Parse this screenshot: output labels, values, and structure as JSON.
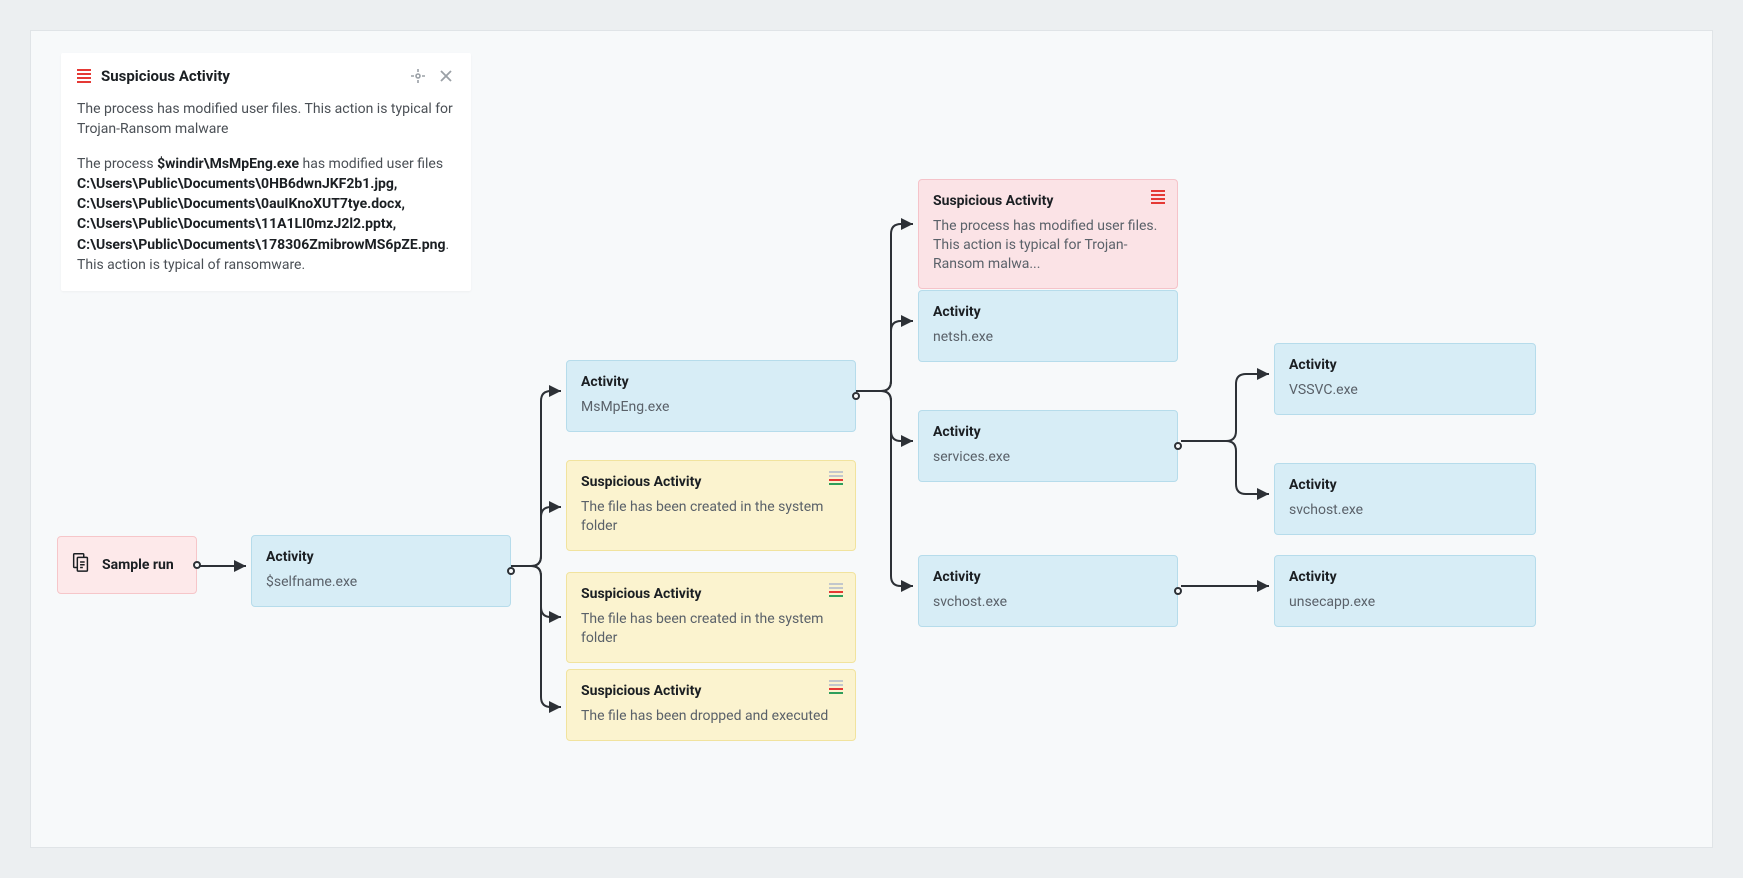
{
  "popup": {
    "title": "Suspicious Activity",
    "description": "The process has modified user files. This action is typical for Trojan-Ransom malware",
    "detail_prefix": "The process ",
    "detail_process": "$windir\\MsMpEng.exe",
    "detail_mid": " has modified user files ",
    "detail_files": "C:\\Users\\Public\\Documents\\0HB6dwnJKF2b1.jpg, C:\\Users\\Public\\Documents\\0auIKnoXUT7tye.docx, C:\\Users\\Public\\Documents\\11A1LI0mzJ2l2.pptx, C:\\Users\\Public\\Documents\\178306ZmibrowMS6pZE.png",
    "detail_suffix": ". This action is typical of ransomware."
  },
  "nodes": {
    "root": {
      "title": "Sample run"
    },
    "sselfname": {
      "title": "Activity",
      "sub": "$selfname.exe"
    },
    "msmpeng": {
      "title": "Activity",
      "sub": "MsMpEng.exe"
    },
    "susp_sys1": {
      "title": "Suspicious Activity",
      "sub": "The file has been created in the system folder"
    },
    "susp_sys2": {
      "title": "Suspicious Activity",
      "sub": "The file has been created in the system folder"
    },
    "susp_drop": {
      "title": "Suspicious Activity",
      "sub": "The file has been dropped and executed"
    },
    "susp_pink": {
      "title": "Suspicious Activity",
      "sub": "The process has modified user files. This action is typical for Trojan-Ransom malwa..."
    },
    "netsh": {
      "title": "Activity",
      "sub": "netsh.exe"
    },
    "services": {
      "title": "Activity",
      "sub": "services.exe"
    },
    "svchost1": {
      "title": "Activity",
      "sub": "svchost.exe"
    },
    "vssvc": {
      "title": "Activity",
      "sub": "VSSVC.exe"
    },
    "svchost2": {
      "title": "Activity",
      "sub": "svchost.exe"
    },
    "unsecapp": {
      "title": "Activity",
      "sub": "unsecapp.exe"
    }
  }
}
